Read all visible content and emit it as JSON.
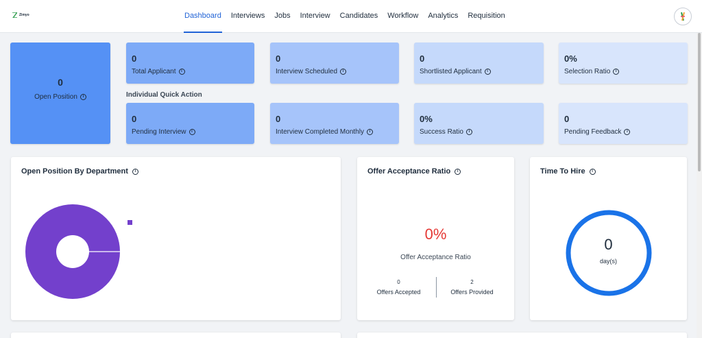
{
  "app": {
    "logo_text": "Zimyo"
  },
  "nav": {
    "items": [
      {
        "label": "Dashboard",
        "active": true
      },
      {
        "label": "Interviews"
      },
      {
        "label": "Jobs"
      },
      {
        "label": "Interview"
      },
      {
        "label": "Candidates"
      },
      {
        "label": "Workflow"
      },
      {
        "label": "Analytics"
      },
      {
        "label": "Requisition"
      }
    ]
  },
  "stats": {
    "open_position": {
      "value": "0",
      "label": "Open Position"
    },
    "total_applicant": {
      "value": "0",
      "label": "Total Applicant"
    },
    "interview_scheduled": {
      "value": "0",
      "label": "Interview Scheduled"
    },
    "shortlisted_applicant": {
      "value": "0",
      "label": "Shortlisted Applicant"
    },
    "selection_ratio": {
      "value": "0%",
      "label": "Selection Ratio"
    },
    "pending_interview": {
      "value": "0",
      "label": "Pending Interview"
    },
    "interview_completed_monthly": {
      "value": "0",
      "label": "Interview Completed Monthly"
    },
    "success_ratio": {
      "value": "0%",
      "label": "Success Ratio"
    },
    "pending_feedback": {
      "value": "0",
      "label": "Pending Feedback"
    }
  },
  "quick_action_label": "Individual Quick Action",
  "info_glyph": "i",
  "cards": {
    "department": {
      "title": "Open Position By Department"
    },
    "offer": {
      "title": "Offer Acceptance Ratio",
      "value": "0%",
      "label": "Offer Acceptance Ratio",
      "accepted_value": "0",
      "accepted_label": "Offers Accepted",
      "provided_value": "2",
      "provided_label": "Offers Provided"
    },
    "hire": {
      "title": "Time To Hire",
      "value": "0",
      "unit": "day(s)"
    }
  },
  "chart_data": {
    "type": "pie",
    "title": "Open Position By Department",
    "categories": [
      ""
    ],
    "values": [
      1
    ],
    "colors": [
      "#7340cc"
    ]
  },
  "colors": {
    "accent": "#1f62d6",
    "donut": "#7340cc",
    "ring": "#1a73e8",
    "ratio": "#e53935"
  }
}
